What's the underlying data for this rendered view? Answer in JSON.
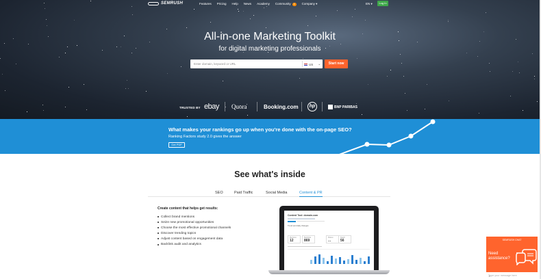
{
  "nav": {
    "logo": "SEMRUSH",
    "links": [
      "Features",
      "Pricing",
      "Help",
      "News",
      "Academy"
    ],
    "community": "Community",
    "community_badge": "4",
    "company": "Company",
    "lang": "EN",
    "login": "Log In"
  },
  "hero": {
    "title": "All-in-one Marketing Toolkit",
    "subtitle": "for digital marketing professionals",
    "search_placeholder": "Enter domain, keyword or URL",
    "country": "US",
    "cta": "Start now"
  },
  "trusted": {
    "label": "TRUSTED BY",
    "brands": [
      "ebay",
      "Quora",
      "Booking.com",
      "hp",
      "BNP PARIBAS"
    ]
  },
  "banner": {
    "question": "What makes your rankings go up when you're done with the on-page SEO?",
    "subtext": "Ranking Factors study 2.0 gives the answer",
    "button": "Get PDF"
  },
  "inside": {
    "title": "See what's inside",
    "tabs": [
      "SEO",
      "Paid Traffic",
      "Social Media",
      "Content & PR"
    ],
    "active_tab": "Content & PR",
    "feature_title": "Create content that helps get results:",
    "features": [
      "Collect brand mentions",
      "Seize new promotional opportunities",
      "Choose the most effective promotional channels",
      "Discover trending topics",
      "Adjust content based on engagement data",
      "Backlink audit and analytics"
    ]
  },
  "screen": {
    "title": "Content Tool: domain.com",
    "trend": "Trend and daily changes",
    "stats": [
      {
        "label": "Mentions",
        "value": "12"
      },
      {
        "label": "Backlinks",
        "value": "869"
      },
      {
        "label": "Shares",
        "value": "..."
      },
      {
        "label": "Reach",
        "value": "56"
      }
    ]
  },
  "chat": {
    "top": "SEMRUSH CHAT",
    "need": "Need assistance?",
    "placeholder": "Type your message here"
  },
  "colors": {
    "brand": "#ff642d",
    "banner": "#1f8fd6",
    "login": "#3fa84a"
  }
}
